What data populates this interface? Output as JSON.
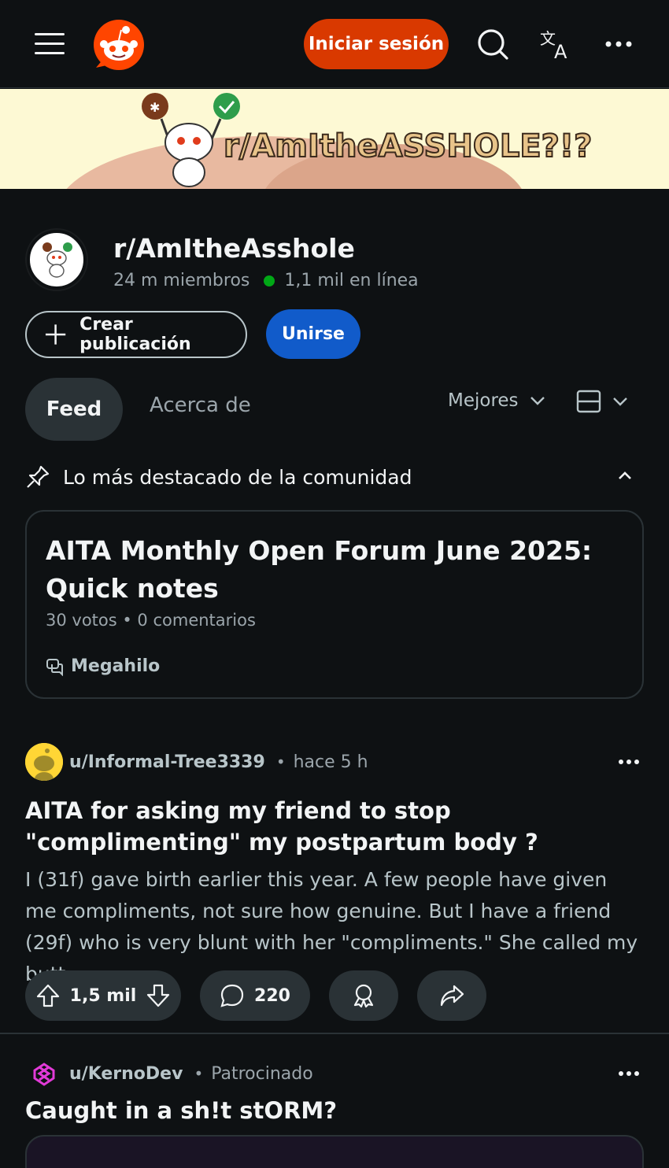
{
  "header": {
    "login_label": "Iniciar sesión"
  },
  "banner": {
    "text": "r/AmItheASSHOLE?!?"
  },
  "community": {
    "name": "r/AmItheAsshole",
    "members": "24 m miembros",
    "online": "1,1 mil en línea",
    "create_label": "Crear publicación",
    "join_label": "Unirse"
  },
  "tabs": {
    "feed": "Feed",
    "about": "Acerca de",
    "sort": "Mejores"
  },
  "highlights": {
    "title": "Lo más destacado de la comunidad",
    "card": {
      "title": "AITA Monthly Open Forum June 2025: Quick notes",
      "meta": "30 votos • 0 comentarios",
      "tag": "Megahilo"
    }
  },
  "post": {
    "author": "u/Informal-Tree3339",
    "separator": "•",
    "time": "hace 5 h",
    "title": "AITA for asking my friend to stop \"complimenting\" my postpartum body ?",
    "body": "I (31f) gave birth earlier this year. A few people have given me compliments, not sure how genuine. But I have a friend (29f) who is very blunt with her \"compliments.\" She called my butt...",
    "votes": "1,5 mil",
    "comments": "220"
  },
  "sponsored": {
    "author": "u/KernoDev",
    "separator": "•",
    "label": "Patrocinado",
    "title": "Caught in a sh!t stORM?"
  },
  "colors": {
    "background": "#0e1113",
    "login": "#d93900",
    "join": "#115bca",
    "online": "#01a816",
    "pill": "#2a3236"
  }
}
